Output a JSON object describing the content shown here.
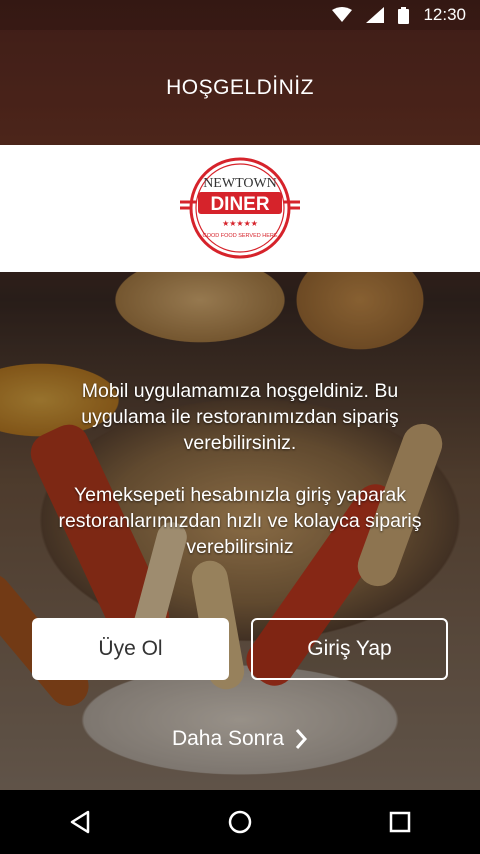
{
  "status_bar": {
    "time": "12:30",
    "icons": [
      "wifi-icon",
      "signal-icon",
      "battery-icon"
    ]
  },
  "header": {
    "title": "HOŞGELDİNİZ"
  },
  "logo": {
    "top_text": "NEWTOWN",
    "main_text": "DINER",
    "tagline": "GOOD FOOD SERVED HERE",
    "stars": "★★★★★",
    "brand_color": "#d6232b"
  },
  "content": {
    "intro": "Mobil uygulamamıza hoşgeldiniz. Bu uygulama ile restoranımızdan sipariş verebilirsiniz.",
    "yemeksepeti": "Yemeksepeti hesabınızla giriş yaparak restoranlarımızdan hızlı ve kolayca sipariş verebilirsiniz"
  },
  "actions": {
    "register_label": "Üye Ol",
    "login_label": "Giriş Yap",
    "later_label": "Daha Sonra"
  },
  "nav": {
    "icons": [
      "back-icon",
      "home-icon",
      "recents-icon"
    ]
  }
}
